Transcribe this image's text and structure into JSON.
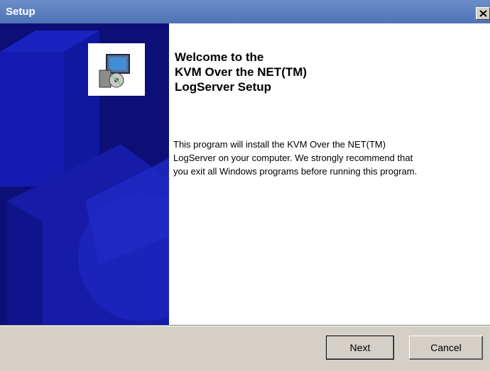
{
  "window": {
    "title": "Setup",
    "close_icon": "close-icon"
  },
  "banner": {
    "icon": "setup-installer-icon",
    "colors": {
      "background": "#0c0f76",
      "shape": "#1a22a8"
    }
  },
  "content": {
    "welcome_lines": [
      "Welcome to the",
      "KVM Over the NET(TM)",
      "LogServer Setup"
    ],
    "description_lines": [
      "This program will install the KVM Over the NET(TM)",
      "LogServer on your computer. We strongly recommend that",
      "you exit all Windows programs before running this program."
    ]
  },
  "buttons": {
    "next_label": "Next",
    "cancel_label": "Cancel"
  }
}
